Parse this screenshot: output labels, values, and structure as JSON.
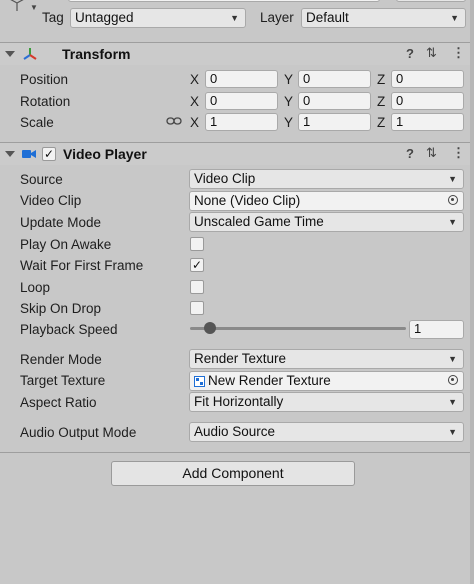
{
  "object_header": {
    "tag_label": "Tag",
    "tag_value": "Untagged",
    "layer_label": "Layer",
    "layer_value": "Default"
  },
  "transform": {
    "title": "Transform",
    "rows": [
      {
        "label": "Position",
        "x": "0",
        "y": "0",
        "z": "0"
      },
      {
        "label": "Rotation",
        "x": "0",
        "y": "0",
        "z": "0"
      },
      {
        "label": "Scale",
        "x": "1",
        "y": "1",
        "z": "1"
      }
    ],
    "axes": {
      "x": "X",
      "y": "Y",
      "z": "Z"
    }
  },
  "video_player": {
    "title": "Video Player",
    "enabled": true,
    "source_label": "Source",
    "source_value": "Video Clip",
    "clip_label": "Video Clip",
    "clip_value": "None (Video Clip)",
    "update_mode_label": "Update Mode",
    "update_mode_value": "Unscaled Game Time",
    "play_on_awake_label": "Play On Awake",
    "play_on_awake": false,
    "wait_first_frame_label": "Wait For First Frame",
    "wait_first_frame": true,
    "loop_label": "Loop",
    "loop": false,
    "skip_on_drop_label": "Skip On Drop",
    "skip_on_drop": false,
    "playback_speed_label": "Playback Speed",
    "playback_speed_value": "1",
    "playback_speed_fraction": 0.0,
    "render_mode_label": "Render Mode",
    "render_mode_value": "Render Texture",
    "target_texture_label": "Target Texture",
    "target_texture_value": "New Render Texture",
    "aspect_ratio_label": "Aspect Ratio",
    "aspect_ratio_value": "Fit Horizontally",
    "audio_output_label": "Audio Output Mode",
    "audio_output_value": "Audio Source"
  },
  "add_component_label": "Add Component",
  "icons": {
    "transform": "transform-axes-icon",
    "video": "video-camera-icon",
    "help": "help-icon",
    "presets": "presets-icon",
    "more": "kebab-menu-icon",
    "link": "constrain-proportions-icon"
  },
  "colors": {
    "panel": "#c8c8c8",
    "field": "#f2f2f2",
    "video_icon": "#1f6fd6"
  }
}
